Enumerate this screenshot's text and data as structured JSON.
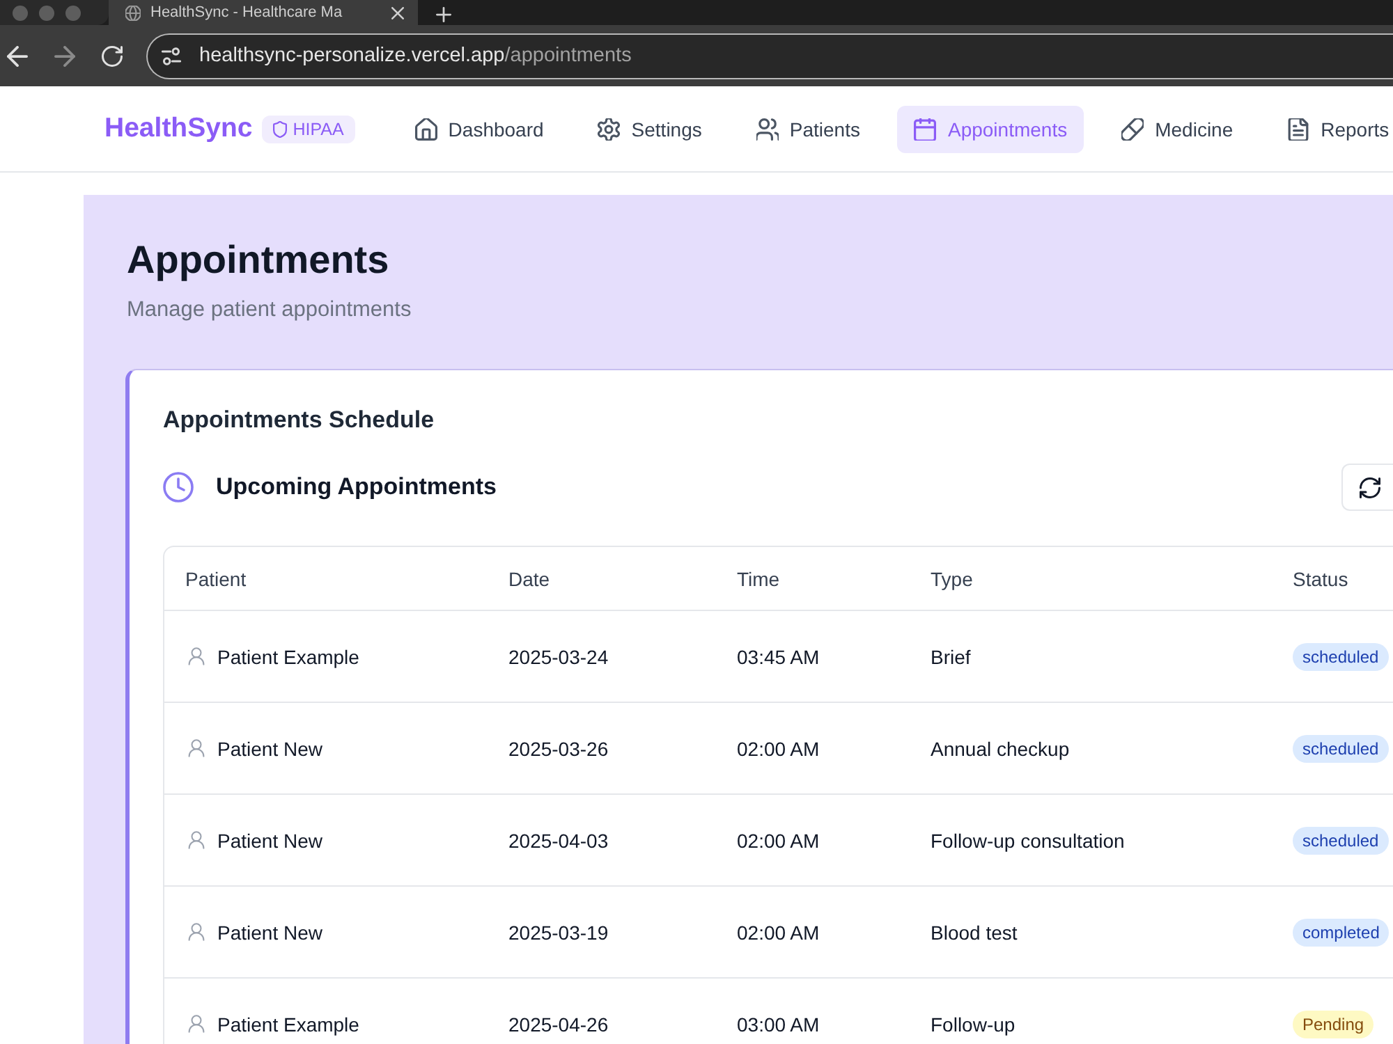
{
  "browser": {
    "tab": {
      "title": "HealthSync - Healthcare Ma"
    },
    "address": {
      "host": "healthsync-personalize.vercel.app",
      "path": "/appointments"
    }
  },
  "navbar": {
    "logo": "HealthSync",
    "badge": "HIPAA",
    "items": [
      {
        "label": "Dashboard",
        "selected": false
      },
      {
        "label": "Settings",
        "selected": false
      },
      {
        "label": "Patients",
        "selected": false
      },
      {
        "label": "Appointments",
        "selected": true
      },
      {
        "label": "Medicine",
        "selected": false
      },
      {
        "label": "Reports",
        "selected": false
      }
    ]
  },
  "page": {
    "title": "Appointments",
    "subtitle": "Manage patient appointments"
  },
  "card": {
    "title": "Appointments Schedule",
    "section_title": "Upcoming Appointments"
  },
  "table": {
    "columns": [
      "Patient",
      "Date",
      "Time",
      "Type",
      "Status"
    ],
    "rows": [
      {
        "patient": "Patient Example",
        "date": "2025-03-24",
        "time": "03:45 AM",
        "type": "Brief",
        "status": {
          "label": "scheduled",
          "color": "#dbeafe"
        }
      },
      {
        "patient": "Patient New",
        "date": "2025-03-26",
        "time": "02:00 AM",
        "type": "Annual checkup",
        "status": {
          "label": "scheduled",
          "color": "#dbeafe"
        }
      },
      {
        "patient": "Patient New",
        "date": "2025-04-03",
        "time": "02:00 AM",
        "type": "Follow-up consultation",
        "status": {
          "label": "scheduled",
          "color": "#dbeafe"
        }
      },
      {
        "patient": "Patient New",
        "date": "2025-03-19",
        "time": "02:00 AM",
        "type": "Blood test",
        "status": {
          "label": "completed",
          "color": "#dbeafe"
        }
      },
      {
        "patient": "Patient Example",
        "date": "2025-04-26",
        "time": "03:00 AM",
        "type": "Follow-up",
        "status": {
          "label": "Pending",
          "color": "#fef9c3"
        }
      }
    ]
  }
}
